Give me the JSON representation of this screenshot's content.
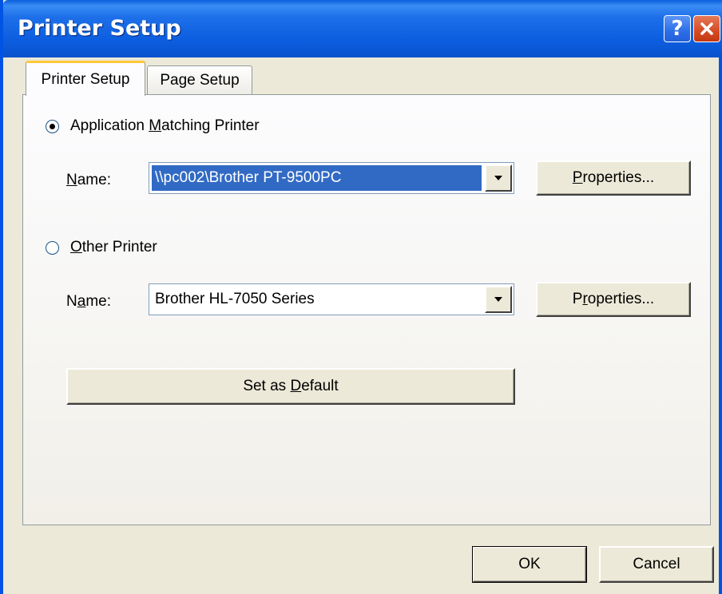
{
  "window": {
    "title": "Printer Setup",
    "help_label": "?",
    "colors": {
      "titlebar": "#0a5fdd",
      "close": "#d64b22",
      "face": "#ece9d8",
      "selection": "#316ac5"
    }
  },
  "tabs": [
    {
      "label": "Printer Setup",
      "active": true
    },
    {
      "label": "Page Setup",
      "active": false
    }
  ],
  "app_printer": {
    "radio_pre": "Application ",
    "radio_accel": "M",
    "radio_post": "atching Printer",
    "checked": true,
    "name_accel": "N",
    "name_post": "ame:",
    "value": "\\\\pc002\\Brother PT-9500PC",
    "properties_accel": "P",
    "properties_post": "roperties..."
  },
  "other_printer": {
    "radio_accel": "O",
    "radio_post": "ther Printer",
    "checked": false,
    "name_pre": "N",
    "name_accel": "a",
    "name_post": "me:",
    "value": "Brother HL-7050 Series",
    "properties_pre": "P",
    "properties_accel": "r",
    "properties_post": "operties..."
  },
  "set_default": {
    "pre": "Set as ",
    "accel": "D",
    "post": "efault"
  },
  "footer": {
    "ok_label": "OK",
    "cancel_label": "Cancel"
  },
  "icons": [
    "help-icon",
    "close-icon",
    "dropdown-arrow-icon",
    "radio-icon"
  ]
}
